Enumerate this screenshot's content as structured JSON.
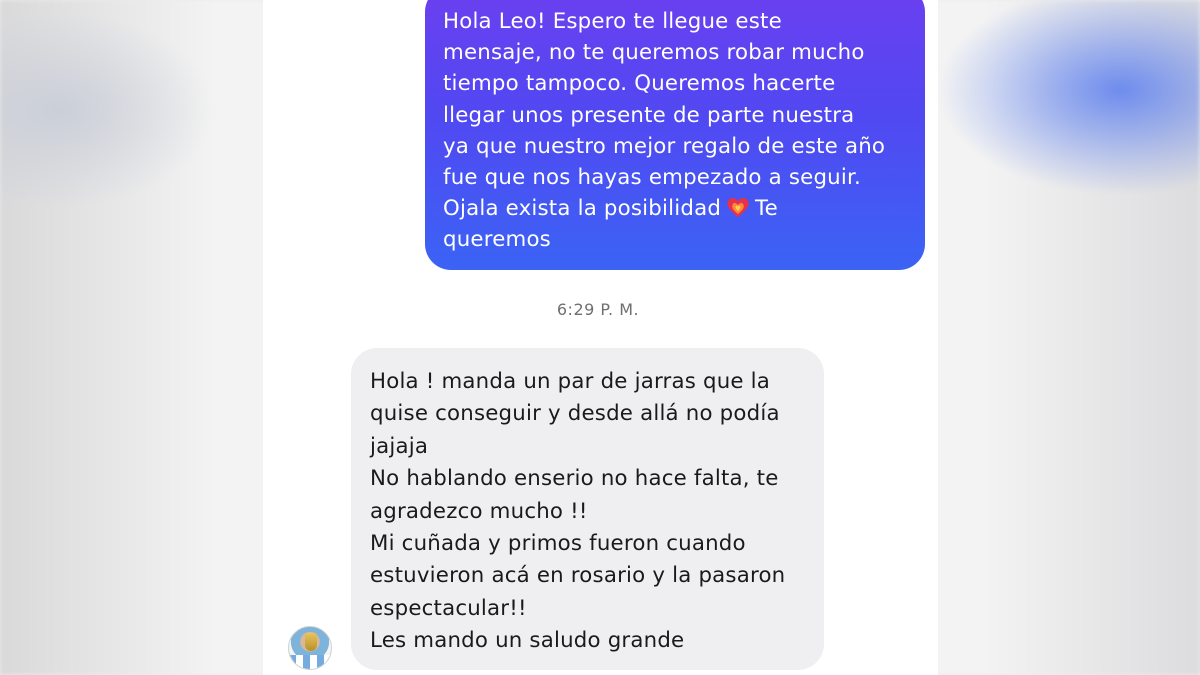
{
  "conversation": {
    "outgoing": {
      "text_before_emoji": "Hola Leo! Espero te llegue este\nmensaje, no te queremos robar mucho\ntiempo tampoco. Queremos hacerte\nllegar unos presente de parte nuestra\nya que nuestro mejor regalo de este año\nfue que nos hayas empezado a seguir.\nOjala exista la posibilidad",
      "emoji": "heart-on-fire-emoji",
      "text_after_emoji": "Te\nqueremos"
    },
    "timestamp": "6:29 P. M.",
    "incoming": {
      "text": "Hola ! manda un par de jarras que la\nquise conseguir y desde allá no podía\njajaja\nNo hablando enserio no hace falta, te\nagradezco mucho !!\nMi cuñada y primos fueron cuando\nestuvieron acá en rosario y la pasaron\nespectacular!!\nLes mando un saludo grande",
      "avatar": "contact-avatar"
    }
  },
  "colors": {
    "outgoing_gradient_top": "#6c3ff0",
    "outgoing_gradient_bottom": "#3b63f4",
    "incoming_bubble": "#efeff1",
    "timestamp": "#6f6f72"
  }
}
